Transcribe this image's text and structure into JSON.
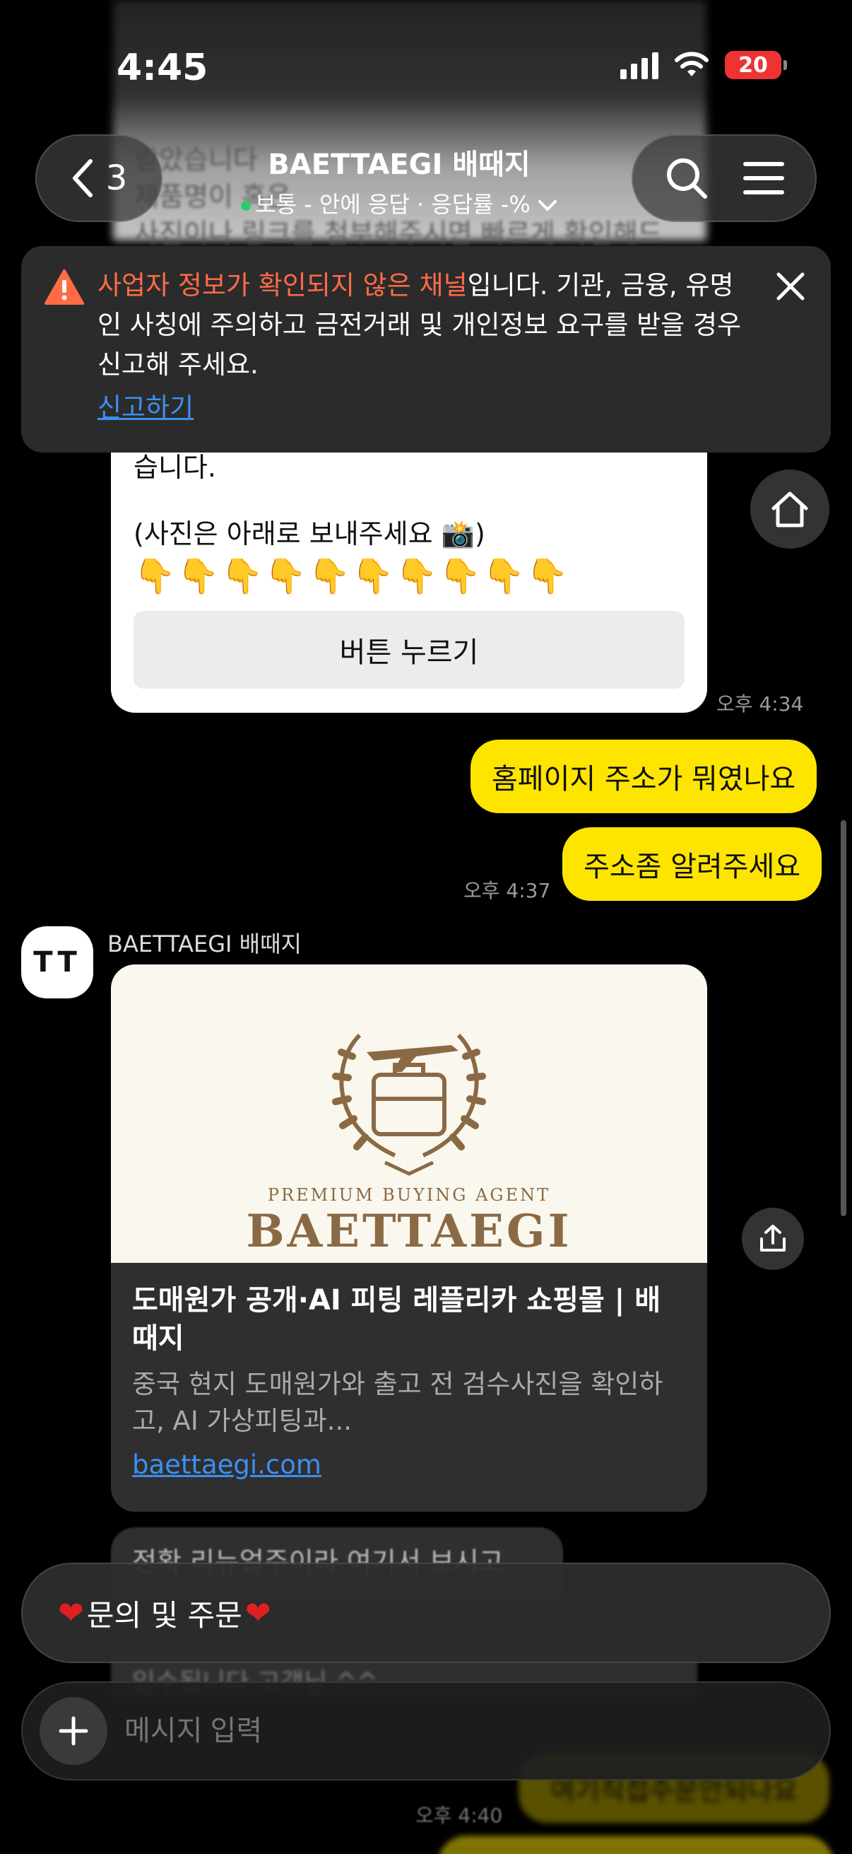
{
  "status": {
    "time": "4:45",
    "battery": "20"
  },
  "nav": {
    "back_count": "3",
    "title": "BAETTAEGI 배때지",
    "subtitle": "보통 - 안에 응답 · 응답률 -%"
  },
  "background_text": [
    "받았습니다",
    "제품명이 혹은",
    "사진이나 링크를 첨부해주시면 빠르게 확인해드"
  ],
  "warning": {
    "highlight": "사업자 정보가 확인되지 않은 채널",
    "text": "입니다. 기관, 금융, 유명인 사칭에 주의하고 금전거래 및 개인정보 요구를 받을 경우 신고해 주세요.",
    "link": "신고하기"
  },
  "card1": {
    "partial_text": "습니다.",
    "photo_text": "(사진은 아래로 보내주세요 📸)",
    "hands": "👇👇👇👇👇👇👇👇👇👇",
    "button": "버튼 누르기",
    "time": "오후 4:34"
  },
  "my_messages": [
    {
      "text": "홈페이지 주소가 뭐였나요"
    },
    {
      "text": "주소좀 알려주세요",
      "time": "오후 4:37"
    }
  ],
  "sender": {
    "name": "BAETTAEGI 배때지",
    "avatar_text": "TT"
  },
  "link_card": {
    "image_tagline": "PREMIUM BUYING AGENT",
    "image_brand": "BAETTAEGI",
    "title": "도매원가 공개·AI 피팅 레플리카 쇼핑몰 | 배때지",
    "description": "중국 현지 도매원가와 출고 전 검수사진을 확인하고, AI 가상피팅과...",
    "url": "baettaegi.com"
  },
  "partial_message": "정확 리뉴얼주이라 여기서 보시고",
  "partial_message2": "입수됩니다 고객님 ^^",
  "quick_reply": {
    "label": "문의 및 주문"
  },
  "bottom": {
    "bubble": "여기직접주문안되나요",
    "time": "오후 4:40"
  },
  "input": {
    "placeholder": "메시지 입력"
  },
  "colors": {
    "accent_yellow": "#fee500",
    "warning_orange": "#ff6b45",
    "link_blue": "#3d8ff0",
    "online_green": "#2ecc71"
  }
}
